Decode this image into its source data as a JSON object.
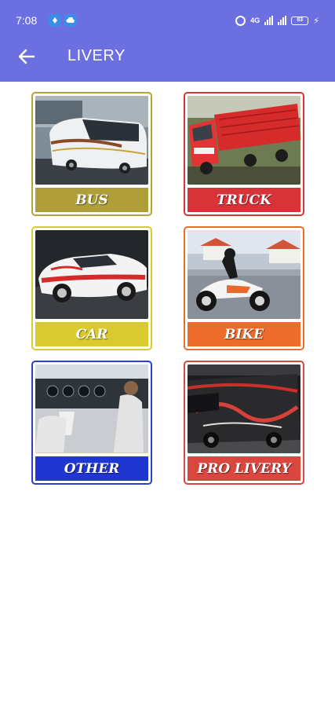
{
  "status_bar": {
    "time": "7:08",
    "network_label": "4G",
    "battery": "83"
  },
  "app_bar": {
    "title": "LIVERY",
    "back_icon": "arrow-left-icon",
    "background_color": "#6b6fe0"
  },
  "categories": [
    {
      "label": "BUS",
      "border_color": "#b6a437",
      "label_color": "#b09e38"
    },
    {
      "label": "TRUCK",
      "border_color": "#d9333a",
      "label_color": "#d9333a"
    },
    {
      "label": "CAR",
      "border_color": "#d9cb2f",
      "label_color": "#d9cb2f"
    },
    {
      "label": "BIKE",
      "border_color": "#ee6c2b",
      "label_color": "#ee6c2b"
    },
    {
      "label": "OTHER",
      "border_color": "#2b3fd0",
      "label_color": "#1f36d0"
    },
    {
      "label": "PRO LIVERY",
      "border_color": "#d9473e",
      "label_color": "#d9473e"
    }
  ]
}
